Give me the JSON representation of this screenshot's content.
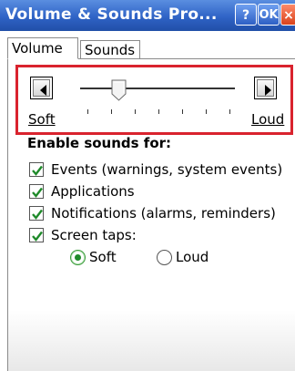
{
  "window": {
    "title": "Volume & Sounds Pro...",
    "help_label": "?",
    "ok_label": "OK",
    "close_label": "×"
  },
  "tabs": [
    {
      "label": "Volume",
      "active": true
    },
    {
      "label": "Sounds",
      "active": false
    }
  ],
  "volume": {
    "decrease_icon": "left-arrow-icon",
    "increase_icon": "right-arrow-icon",
    "soft_label": "Soft",
    "loud_label": "Loud",
    "level_fraction": 0.22,
    "tick_count": 7
  },
  "sounds_section": {
    "label": "Enable sounds for:",
    "options": [
      {
        "label": "Events (warnings, system events)",
        "checked": true
      },
      {
        "label": "Applications",
        "checked": true
      },
      {
        "label": "Notifications (alarms, reminders)",
        "checked": true
      },
      {
        "label": "Screen taps:",
        "checked": true
      }
    ],
    "screen_taps": {
      "soft_label": "Soft",
      "loud_label": "Loud",
      "selected": "Soft"
    }
  },
  "colors": {
    "titlebar": "#2f63c6",
    "highlight_box": "#d9232e",
    "check": "#1f8a2a"
  }
}
